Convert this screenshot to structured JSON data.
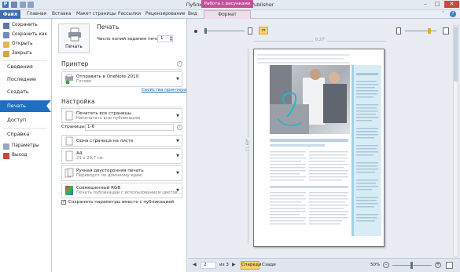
{
  "window": {
    "title": "Публикация3 - Microsoft Publisher",
    "context_tab": "Работа с рисунками",
    "min": "–",
    "max": "□",
    "close": "✕"
  },
  "ribbon": {
    "tabs": [
      "Файл",
      "Главная",
      "Вставка",
      "Макет страницы",
      "Рассылки",
      "Рецензирование",
      "Вид",
      "Формат"
    ]
  },
  "sidebar": {
    "save": "Сохранить",
    "save_as": "Сохранить как",
    "open": "Открыть",
    "close": "Закрыть",
    "info": "Сведения",
    "recent": "Последние",
    "create": "Создать",
    "print": "Печать",
    "share": "Доступ",
    "help": "Справка",
    "options": "Параметры",
    "exit": "Выход"
  },
  "print": {
    "header": "Печать",
    "button_label": "Печать",
    "copies_label": "Число копий задания печати:",
    "copies_value": "1"
  },
  "printer": {
    "header": "Принтер",
    "name": "Отправить в OneNote 2010",
    "status": "Готово",
    "properties_link": "Свойства принтера"
  },
  "settings": {
    "header": "Настройка",
    "pages_main": "Печатать все страницы",
    "pages_sub": "Напечатать всю публикацию",
    "pages_label": "Страницы:",
    "pages_value": "1-6",
    "layout_main": "Одна страница на листе",
    "paper_main": "А4",
    "paper_sub": "21 x 29,7 см",
    "duplex_main": "Ручная двусторонняя печать",
    "duplex_sub": "Переворот по длинному краю",
    "color_main": "Совмещенный RGB",
    "color_sub": "Печать публикации с использованием цветов ...",
    "save_checkbox": "Сохранить параметры вместе с публикацией"
  },
  "preview": {
    "width_label": "8,27\"",
    "height_label": "11,69\""
  },
  "status": {
    "page_value": "2",
    "page_of": "из 3",
    "front": "Спереди",
    "back": "Сзади",
    "zoom": "50%"
  },
  "colors": {
    "accent": "#1e6fc2",
    "file_tab": "#3d6db3",
    "context": "#c0529a",
    "highlight": "#f7d26b"
  }
}
